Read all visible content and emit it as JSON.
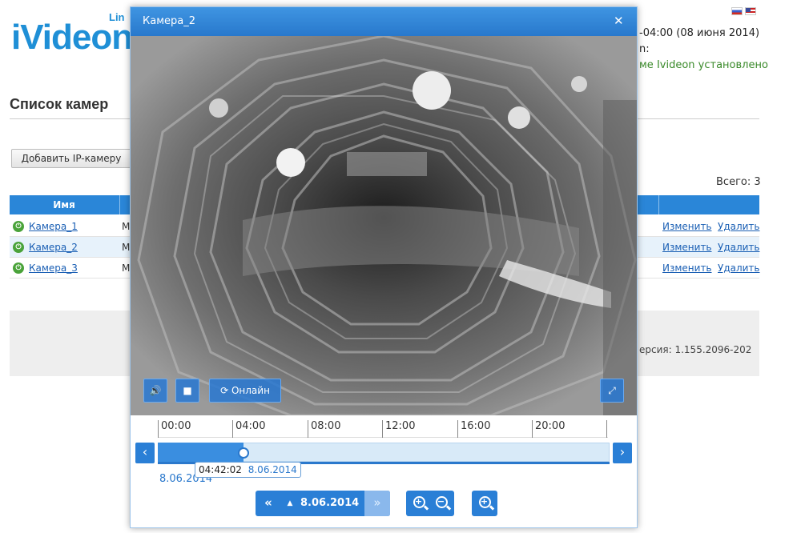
{
  "header": {
    "logo": "iVideon",
    "logo_sub": "Lin",
    "time_text": "-04:00 (08 июня 2014)",
    "colon_text": "n:",
    "status_text": "ме Ivideon установлено"
  },
  "page": {
    "title": "Список камер",
    "add_camera_label": "Добавить IP-камеру",
    "total_label": "Всего: 3",
    "name_column": "Имя"
  },
  "cameras": [
    {
      "name": "Камера_1",
      "model": "M",
      "edit": "Изменить",
      "delete": "Удалить"
    },
    {
      "name": "Камера_2",
      "model": "M",
      "edit": "Изменить",
      "delete": "Удалить"
    },
    {
      "name": "Камера_3",
      "model": "M",
      "edit": "Изменить",
      "delete": "Удалить"
    }
  ],
  "footer": {
    "version": "ерсия: 1.155.2096-202"
  },
  "modal": {
    "title": "Камера_2",
    "close_icon": "close-icon",
    "online_label": "Онлайн",
    "timeline_ticks": [
      "00:00",
      "04:00",
      "08:00",
      "12:00",
      "16:00",
      "20:00"
    ],
    "playback_fraction": 0.19,
    "tooltip_time": "04:42:02",
    "tooltip_date": "8.06.2014",
    "date_below": "8.06.2014",
    "date_nav_label": "8.06.2014"
  },
  "colors": {
    "brand": "#1f8fd6",
    "header_blue": "#2a86d8",
    "status_green": "#3a8a2a"
  }
}
